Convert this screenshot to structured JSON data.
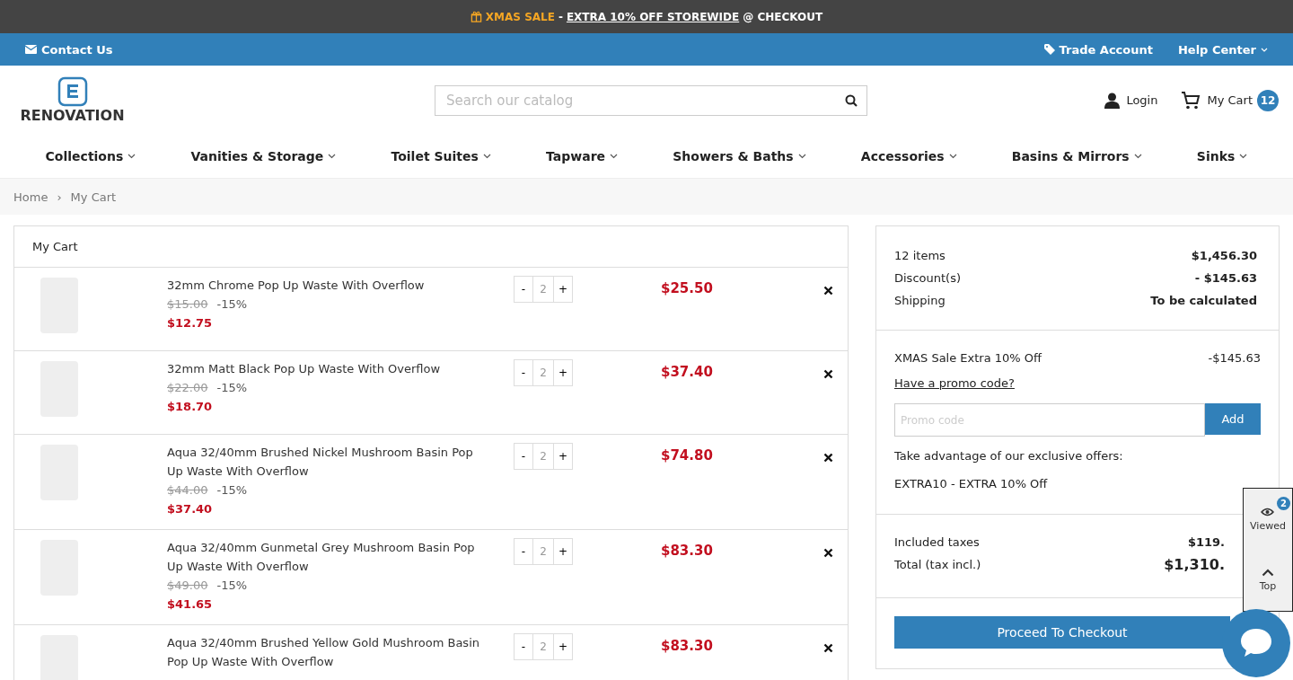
{
  "promo_bar": {
    "sale": "XMAS SALE",
    "dash": "-",
    "offer": "EXTRA 10% OFF STOREWIDE",
    "suffix": "@ CHECKOUT"
  },
  "top_bar": {
    "contact": "Contact Us",
    "trade": "Trade Account",
    "help": "Help Center"
  },
  "header": {
    "logo": "RENOVATION",
    "search_placeholder": "Search our catalog",
    "login": "Login",
    "cart": "My Cart",
    "cart_count": "12"
  },
  "nav": [
    "Collections",
    "Vanities & Storage",
    "Toilet Suites",
    "Tapware",
    "Showers & Baths",
    "Accessories",
    "Basins & Mirrors",
    "Sinks"
  ],
  "breadcrumb": {
    "items": [
      "Home",
      "My Cart"
    ],
    "separator": "›"
  },
  "cart": {
    "title": "My Cart",
    "items": [
      {
        "name": "32mm Chrome Pop Up Waste With Overflow",
        "old_price": "$15.00",
        "discount": "-15%",
        "price": "$12.75",
        "minus": "-",
        "qty": "2",
        "plus": "+",
        "total": "$25.50"
      },
      {
        "name": "32mm Matt Black Pop Up Waste With Overflow",
        "old_price": "$22.00",
        "discount": "-15%",
        "price": "$18.70",
        "minus": "-",
        "qty": "2",
        "plus": "+",
        "total": "$37.40"
      },
      {
        "name": "Aqua 32/40mm Brushed Nickel Mushroom Basin Pop Up Waste With Overflow",
        "old_price": "$44.00",
        "discount": "-15%",
        "price": "$37.40",
        "minus": "-",
        "qty": "2",
        "plus": "+",
        "total": "$74.80"
      },
      {
        "name": "Aqua 32/40mm Gunmetal Grey Mushroom Basin Pop Up Waste With Overflow",
        "old_price": "$49.00",
        "discount": "-15%",
        "price": "$41.65",
        "minus": "-",
        "qty": "2",
        "plus": "+",
        "total": "$83.30"
      },
      {
        "name": "Aqua 32/40mm Brushed Yellow Gold Mushroom Basin Pop Up Waste With Overflow",
        "minus": "-",
        "qty": "2",
        "plus": "+",
        "total": "$83.30"
      }
    ]
  },
  "summary": {
    "lines": [
      {
        "label": "12 items",
        "value": "$1,456.30"
      },
      {
        "label": "Discount(s)",
        "value": "- $145.63"
      },
      {
        "label": "Shipping",
        "value": "To be calculated"
      }
    ],
    "voucher": {
      "label": "XMAS Sale Extra 10% Off",
      "value": "-$145.63"
    },
    "promo_link": "Have a promo code?",
    "promo_placeholder": "Promo code",
    "add": "Add",
    "offers_intro": "Take advantage of our exclusive offers:",
    "offer": "EXTRA10 - EXTRA 10% Off",
    "totals": [
      {
        "label": "Included taxes",
        "value": "$119."
      },
      {
        "label": "Total (tax incl.)",
        "value": "$1,310."
      }
    ],
    "checkout": "Proceed To Checkout"
  },
  "side_widget": {
    "viewed": "Viewed",
    "viewed_count": "2",
    "top": "Top"
  }
}
